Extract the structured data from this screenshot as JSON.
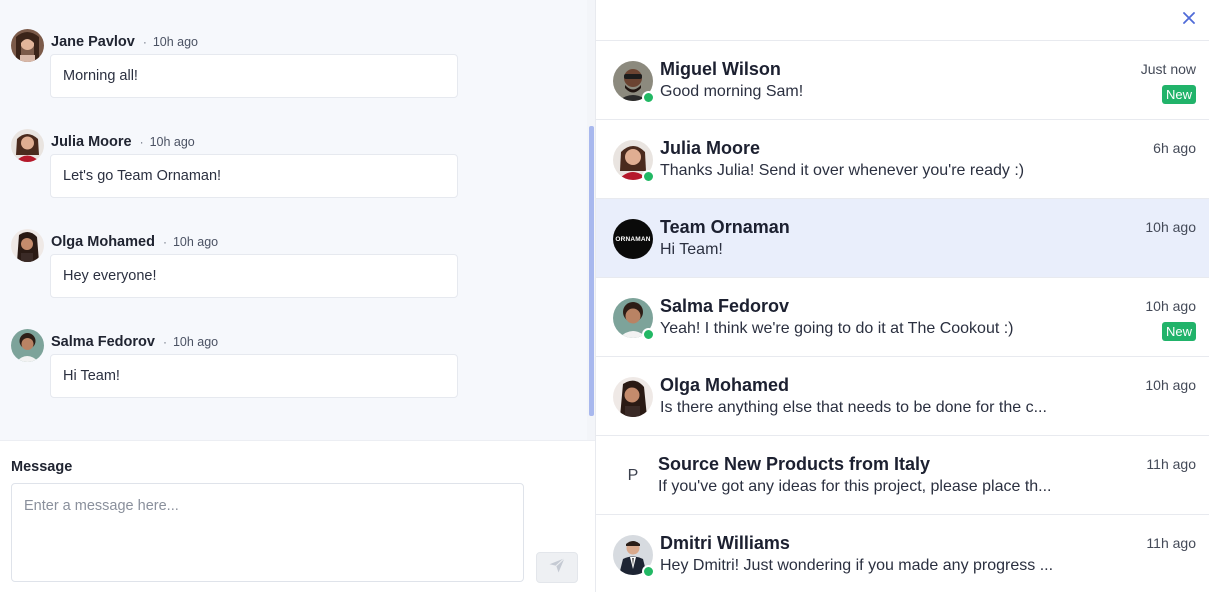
{
  "chat": {
    "messages": [
      {
        "author": "Jane Pavlov",
        "time": "10h ago",
        "text": "Morning all!"
      },
      {
        "author": "Julia Moore",
        "time": "10h ago",
        "text": "Let's go Team Ornaman!"
      },
      {
        "author": "Olga Mohamed",
        "time": "10h ago",
        "text": "Hey everyone!"
      },
      {
        "author": "Salma Fedorov",
        "time": "10h ago",
        "text": "Hi Team!"
      }
    ],
    "separator": "·"
  },
  "composer": {
    "label": "Message",
    "placeholder": "Enter a message here...",
    "value": ""
  },
  "conversations": [
    {
      "name": "Miguel Wilson",
      "preview": "Good morning Sam!",
      "time": "Just now",
      "badge": "New",
      "online": true
    },
    {
      "name": "Julia Moore",
      "preview": "Thanks Julia! Send it over whenever you're ready :)",
      "time": "6h ago",
      "online": true
    },
    {
      "name": "Team Ornaman",
      "preview": "Hi Team!",
      "time": "10h ago",
      "selected": true,
      "logo_text": "ORNAMAN"
    },
    {
      "name": "Salma Fedorov",
      "preview": "Yeah! I think we're going to do it at The Cookout :)",
      "time": "10h ago",
      "badge": "New",
      "online": true
    },
    {
      "name": "Olga Mohamed",
      "preview": "Is there anything else that needs to be done for the c...",
      "time": "10h ago"
    },
    {
      "name": "Source New Products from Italy",
      "preview": "If you've got any ideas for this project, please place th...",
      "time": "11h ago",
      "avatar_letter": "P"
    },
    {
      "name": "Dmitri Williams",
      "preview": "Hey Dmitri! Just wondering if you made any progress ...",
      "time": "11h ago",
      "online": true
    }
  ],
  "colors": {
    "accent": "#a8b8ee",
    "online": "#22b864",
    "new_badge": "#21b36a",
    "selected_row": "#e9eefb",
    "close_icon": "#4f6bd8"
  },
  "icons": {
    "close": "close-icon",
    "send": "send-icon"
  }
}
